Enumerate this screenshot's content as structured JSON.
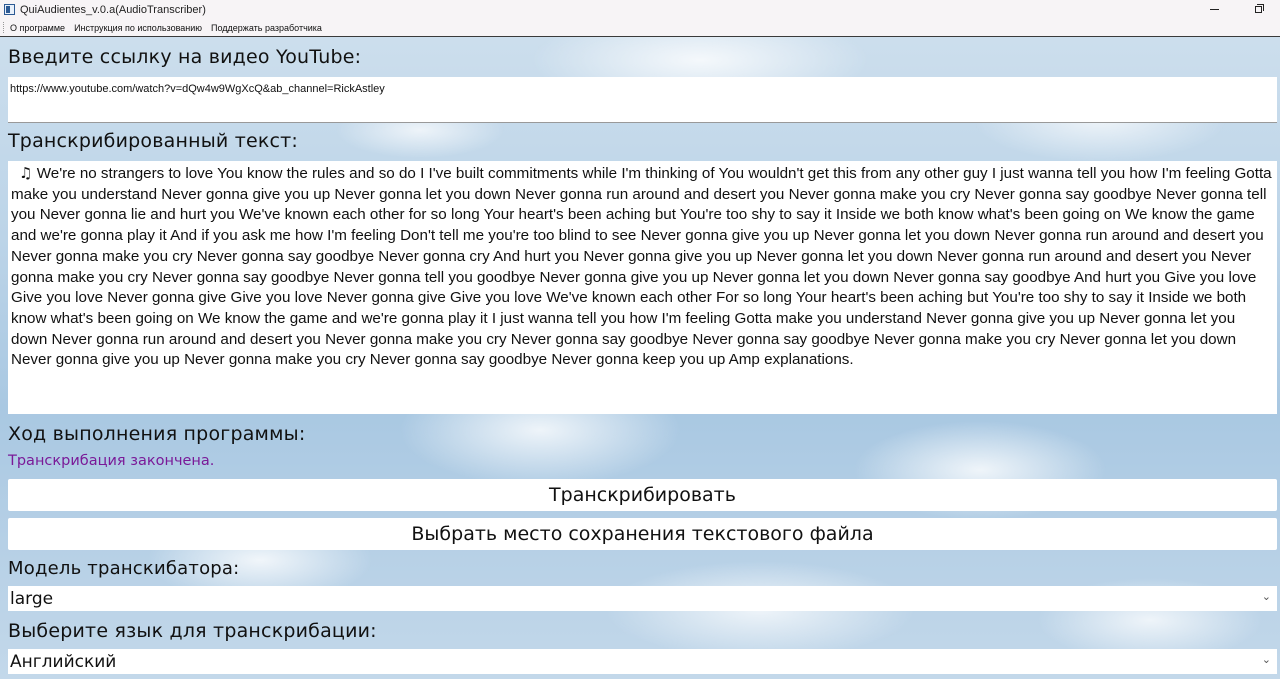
{
  "window": {
    "title": "QuiAudientes_v.0.a(AudioTranscriber)",
    "minimize_icon": "minimize-icon",
    "maximize_icon": "maximize-icon"
  },
  "menu": {
    "items": [
      "О программе",
      "Инструкция по использованию",
      "Поддержать разработчика"
    ]
  },
  "url_section": {
    "label": "Введите ссылку на видео YouTube:",
    "value": "https://www.youtube.com/watch?v=dQw4w9WgXcQ&ab_channel=RickAstley"
  },
  "transcript_section": {
    "label": "Транскрибированный текст:",
    "icon": "music-note-icon",
    "text": "We're no strangers to love You know the rules and so do I I've built commitments while I'm thinking of You wouldn't get this from any other guy I just wanna tell you how I'm feeling Gotta make you understand Never gonna give you up Never gonna let you down Never gonna run around and desert you Never gonna make you cry Never gonna say goodbye Never gonna tell you Never gonna lie and hurt you We've known each other for so long Your heart's been aching but You're too shy to say it Inside we both know what's been going on We know the game and we're gonna play it And if you ask me how I'm feeling Don't tell me you're too blind to see Never gonna give you up Never gonna let you down Never gonna run around and desert you Never gonna make you cry Never gonna say goodbye Never gonna cry And hurt you Never gonna give you up Never gonna let you down Never gonna run around and desert you Never gonna make you cry Never gonna say goodbye Never gonna tell you goodbye Never gonna give you up Never gonna let you down Never gonna say goodbye And hurt you Give you love Give you love Never gonna give Give you love Never gonna give Give you love We've known each other For so long Your heart's been aching but You're too shy to say it Inside we both know what's been going on We know the game and we're gonna play it I just wanna tell you how I'm feeling Gotta make you understand Never gonna give you up Never gonna let you down Never gonna run around and desert you Never gonna make you cry Never gonna say goodbye Never gonna say goodbye Never gonna make you cry Never gonna let you down Never gonna give you up Never gonna make you cry Never gonna say goodbye Never gonna keep you up Amp explanations."
  },
  "progress_section": {
    "label": "Ход выполнения программы:",
    "status": "Транскрибация закончена.",
    "status_color": "#7a1a98"
  },
  "buttons": {
    "transcribe": "Транскрибировать",
    "choose_location": "Выбрать место сохранения текстового файла"
  },
  "model_section": {
    "label": "Модель транскибатора:",
    "selected": "large"
  },
  "language_section": {
    "label": "Выберите язык для транскрибации:",
    "selected": "Английский"
  }
}
